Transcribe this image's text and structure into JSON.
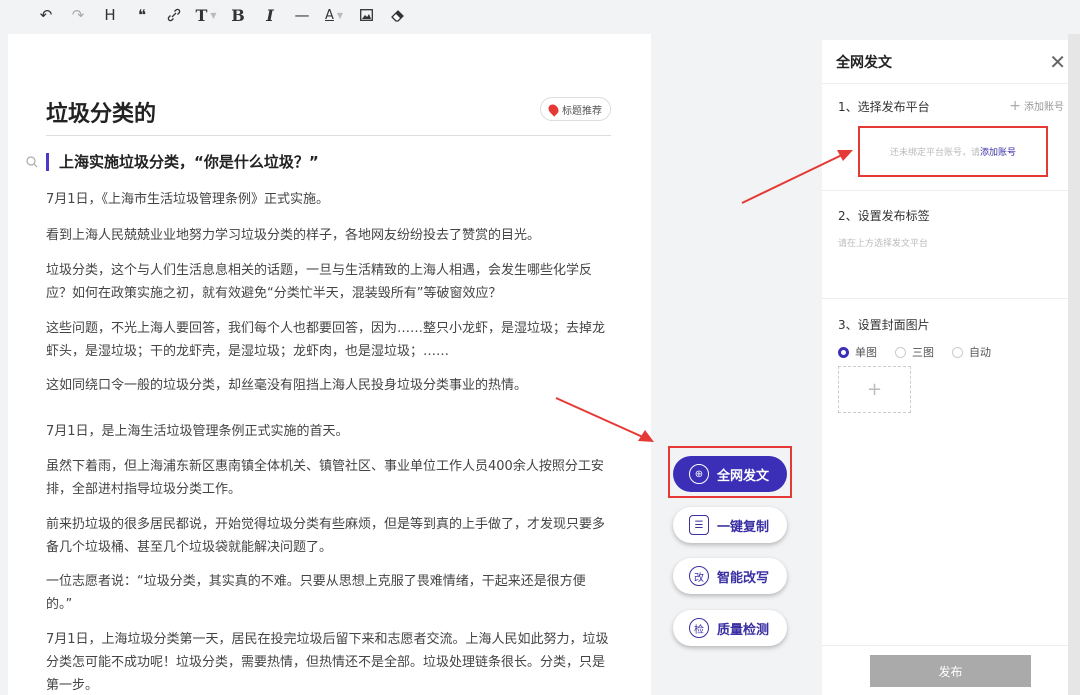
{
  "toolbar": {
    "items": [
      {
        "name": "undo-icon",
        "glyph": "↶"
      },
      {
        "name": "redo-icon",
        "glyph": "↷"
      },
      {
        "name": "heading-icon",
        "glyph": "H"
      },
      {
        "name": "quote-icon",
        "glyph": "❝"
      },
      {
        "name": "link-icon",
        "glyph": "🔗"
      },
      {
        "name": "font-size-icon",
        "glyph": "T"
      },
      {
        "name": "bold-icon",
        "glyph": "B"
      },
      {
        "name": "italic-icon",
        "glyph": "I"
      },
      {
        "name": "divider-icon",
        "glyph": "—"
      },
      {
        "name": "font-color-icon",
        "glyph": "A"
      },
      {
        "name": "image-icon",
        "glyph": "▣"
      },
      {
        "name": "eraser-icon",
        "glyph": "⌫"
      }
    ]
  },
  "editor": {
    "title": "垃圾分类的",
    "title_rec_label": "标题推荐",
    "section_heading": "上海实施垃圾分类，“你是什么垃圾？”",
    "paragraphs": [
      "7月1日，《上海市生活垃圾管理条例》正式实施。",
      "看到上海人民兢兢业业地努力学习垃圾分类的样子，各地网友纷纷投去了赞赏的目光。",
      "垃圾分类，这个与人们生活息息相关的话题，一旦与生活精致的上海人相遇，会发生哪些化学反应？如何在政策实施之初，就有效避免“分类忙半天，混装毁所有”等破窗效应？",
      "这些问题，不光上海人要回答，我们每个人也都要回答，因为……整只小龙虾，是湿垃圾；去掉龙虾头，是湿垃圾；干的龙虾壳，是湿垃圾；龙虾肉，也是湿垃圾；……",
      "这如同绕口令一般的垃圾分类，却丝毫没有阻挡上海人民投身垃圾分类事业的热情。",
      "7月1日，是上海生活垃圾管理条例正式实施的首天。",
      "虽然下着雨，但上海浦东新区惠南镇全体机关、镇管社区、事业单位工作人员400余人按照分工安排，全部进村指导垃圾分类工作。",
      "前来扔垃圾的很多居民都说，开始觉得垃圾分类有些麻烦，但是等到真的上手做了，才发现只要多备几个垃圾桶、甚至几个垃圾袋就能解决问题了。",
      "一位志愿者说：“垃圾分类，其实真的不难。只要从思想上克服了畏难情绪，干起来还是很方便的。”",
      "7月1日，上海垃圾分类第一天，居民在投完垃圾后留下来和志愿者交流。上海人民如此努力，垃圾分类怎可能不成功呢！垃圾分类，需要热情，但热情还不是全部。垃圾处理链条很长。分类，只是第一步。"
    ]
  },
  "actions": {
    "publish_all": {
      "label": "全网发文",
      "icon": "globe-icon",
      "glyph": "⊕"
    },
    "copy": {
      "label": "一键复制",
      "icon": "copy-icon",
      "glyph": "☰"
    },
    "rewrite": {
      "label": "智能改写",
      "icon": "rewrite-icon",
      "glyph": "改"
    },
    "check": {
      "label": "质量检测",
      "icon": "check-icon",
      "glyph": "检"
    }
  },
  "panel": {
    "title": "全网发文",
    "step1_title": "1、选择发布平台",
    "add_account": "添加账号",
    "unbound_text": "还未绑定平台账号，请",
    "unbound_link": "添加账号",
    "step2_title": "2、设置发布标签",
    "step2_hint": "请在上方选择发文平台",
    "step3_title": "3、设置封面图片",
    "cover_options": [
      "单图",
      "三图",
      "自动"
    ],
    "cover_selected": "单图",
    "publish_label": "发布"
  },
  "colors": {
    "accent": "#3b2fb8",
    "annotation_red": "#e53935"
  }
}
